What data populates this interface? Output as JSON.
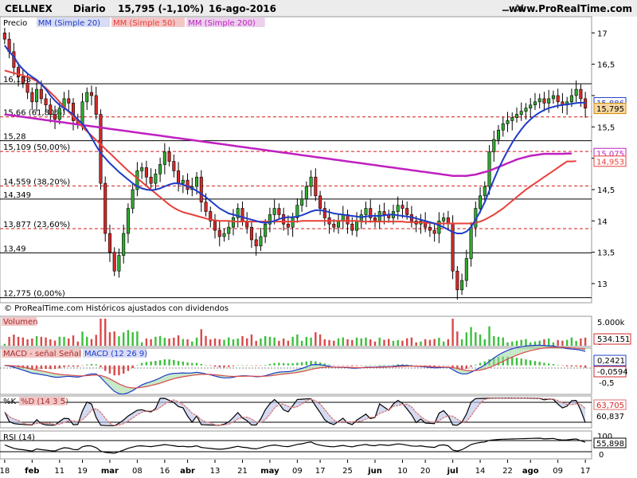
{
  "header": {
    "title": "CELLNEX",
    "period": "Diario",
    "quote": "15,795 (-1,10%)",
    "date": "16-ago-2016",
    "site": "www.ProRealTime.com"
  },
  "icons": {
    "minimize": "minimize-icon",
    "close": "close-icon"
  },
  "colors": {
    "bg": "#ffffff",
    "candle_up": "#2eab2e",
    "candle_down": "#d62828",
    "sma20": "#1e3cc8",
    "sma50": "#e8403a",
    "sma200": "#c020c0",
    "fib_line": "#d01a1a",
    "hline": "#000000",
    "volume": "#3cbf3c",
    "volume_down": "#d84a4a",
    "macd_hist_up": "#3cbf3c",
    "macd_hist_down": "#d84a4a",
    "stoch_k": "#000000",
    "stoch_d": "#d87070",
    "rsi": "#000000"
  },
  "chart_data": {
    "price": {
      "legend": [
        {
          "label": "Precio",
          "color": "#000000"
        },
        {
          "label": "MM (Simple 20)",
          "color": "#1e3cc8"
        },
        {
          "label": "MM (Simple 50)",
          "color": "#e8403a"
        },
        {
          "label": "MM (Simple 200)",
          "color": "#c020c0"
        }
      ],
      "ylim": [
        12.72,
        17.22
      ],
      "yticks": [
        13,
        13.5,
        14,
        14.5,
        15,
        15.5,
        16,
        16.5,
        17
      ],
      "ytick_labels": [
        "13",
        "13,5",
        "14",
        "14,5",
        "",
        "15,5",
        "",
        "16,5",
        "17"
      ],
      "horizontal_levels": [
        {
          "label": "16,188",
          "value": 16.188,
          "style": "solid"
        },
        {
          "label": "15,66 (61,80%)",
          "value": 15.66,
          "style": "dashed"
        },
        {
          "label": "15,28",
          "value": 15.28,
          "style": "solid"
        },
        {
          "label": "15,109 (50,00%)",
          "value": 15.109,
          "style": "dashed"
        },
        {
          "label": "14,559 (38,20%)",
          "value": 14.559,
          "style": "dashed"
        },
        {
          "label": "14,349",
          "value": 14.349,
          "style": "solid"
        },
        {
          "label": "13,877 (23,60%)",
          "value": 13.877,
          "style": "dashed"
        },
        {
          "label": "13,49",
          "value": 13.49,
          "style": "solid"
        },
        {
          "label": "12,775 (0,00%)",
          "value": 12.775,
          "style": "solid"
        }
      ],
      "right_labels": [
        {
          "text": "15,886",
          "value": 15.886,
          "color": "#1e3cc8"
        },
        {
          "text": "15,795",
          "value": 15.795,
          "color": "#000000"
        },
        {
          "text": "15,075",
          "value": 15.075,
          "color": "#c020c0"
        },
        {
          "text": "14,953",
          "value": 14.953,
          "color": "#e8403a"
        }
      ],
      "close": [
        16.9,
        16.7,
        16.45,
        16.3,
        16.2,
        16.05,
        15.9,
        16.1,
        15.95,
        15.85,
        15.7,
        15.62,
        15.8,
        15.95,
        15.88,
        15.6,
        15.55,
        15.9,
        16.05,
        16.0,
        15.7,
        14.6,
        13.8,
        13.5,
        13.2,
        13.45,
        13.8,
        14.2,
        14.5,
        14.8,
        14.85,
        14.7,
        14.6,
        14.75,
        14.9,
        15.1,
        14.95,
        14.8,
        14.6,
        14.65,
        14.5,
        14.55,
        14.7,
        14.3,
        14.15,
        14.0,
        13.85,
        13.75,
        13.8,
        13.9,
        14.05,
        14.2,
        14.0,
        13.9,
        13.7,
        13.6,
        13.75,
        13.95,
        14.1,
        14.2,
        14.1,
        13.95,
        13.9,
        14.05,
        14.25,
        14.35,
        14.55,
        14.7,
        14.4,
        14.2,
        14.05,
        13.95,
        13.9,
        14.0,
        14.1,
        13.95,
        13.85,
        14.0,
        14.1,
        14.2,
        14.05,
        14.0,
        14.15,
        14.1,
        14.05,
        14.15,
        14.25,
        14.2,
        14.1,
        14.0,
        13.95,
        14.0,
        13.9,
        13.85,
        13.8,
        14.0,
        14.05,
        13.95,
        13.2,
        12.9,
        13.05,
        13.4,
        13.9,
        14.2,
        14.4,
        14.55,
        15.1,
        15.3,
        15.45,
        15.55,
        15.6,
        15.65,
        15.7,
        15.75,
        15.8,
        15.85,
        15.9,
        15.95,
        15.88,
        15.95,
        16.0,
        15.9,
        15.85,
        15.9,
        16.0,
        16.1,
        15.95,
        15.8
      ],
      "sma20": [
        16.8,
        16.7,
        16.62,
        16.5,
        16.42,
        16.35,
        16.3,
        16.25,
        16.18,
        16.1,
        16.0,
        15.92,
        15.85,
        15.8,
        15.75,
        15.7,
        15.62,
        15.55,
        15.45,
        15.33,
        15.2,
        15.08,
        15.0,
        14.92,
        14.85,
        14.78,
        14.72,
        14.66,
        14.6,
        14.55,
        14.52,
        14.5,
        14.49,
        14.5,
        14.52,
        14.55,
        14.58,
        14.6,
        14.6,
        14.58,
        14.55,
        14.52,
        14.48,
        14.43,
        14.38,
        14.32,
        14.26,
        14.2,
        14.16,
        14.12,
        14.1,
        14.08,
        14.06,
        14.04,
        14.02,
        14.0,
        13.98,
        13.97,
        13.98,
        14.0,
        14.03,
        14.05,
        14.06,
        14.06,
        14.07,
        14.09,
        14.12,
        14.15,
        14.17,
        14.17,
        14.16,
        14.14,
        14.12,
        14.11,
        14.1,
        14.09,
        14.08,
        14.07,
        14.06,
        14.07,
        14.08,
        14.08,
        14.08,
        14.09,
        14.1,
        14.1,
        14.09,
        14.08,
        14.07,
        14.06,
        14.04,
        14.02,
        14.0,
        13.98,
        13.96,
        13.93,
        13.9,
        13.86,
        13.82,
        13.8,
        13.8,
        13.83,
        13.9,
        14.02,
        14.15,
        14.3,
        14.48,
        14.66,
        14.83,
        14.98,
        15.12,
        15.25,
        15.36,
        15.46,
        15.55,
        15.62,
        15.68,
        15.73,
        15.77,
        15.8,
        15.82,
        15.84,
        15.85,
        15.86,
        15.87,
        15.88,
        15.886,
        15.886
      ],
      "sma50": [
        16.4,
        16.38,
        16.36,
        16.34,
        16.32,
        16.3,
        16.27,
        16.23,
        16.18,
        16.12,
        16.05,
        15.98,
        15.9,
        15.82,
        15.74,
        15.66,
        15.58,
        15.5,
        15.43,
        15.36,
        15.29,
        15.22,
        15.15,
        15.08,
        15.01,
        14.94,
        14.87,
        14.8,
        14.74,
        14.68,
        14.62,
        14.56,
        14.5,
        14.44,
        14.38,
        14.32,
        14.26,
        14.21,
        14.17,
        14.14,
        14.12,
        14.1,
        14.08,
        14.06,
        14.04,
        14.02,
        14.01,
        14.0,
        14.0,
        14.0,
        13.99,
        13.99,
        13.99,
        13.99,
        13.99,
        13.99,
        13.99,
        13.99,
        13.99,
        13.99,
        13.99,
        13.99,
        13.99,
        13.99,
        13.99,
        14.0,
        14.0,
        14.0,
        14.0,
        14.0,
        14.0,
        14.0,
        14.0,
        14.0,
        14.0,
        14.0,
        14.0,
        14.0,
        13.99,
        13.99,
        13.99,
        13.99,
        13.99,
        13.99,
        13.99,
        13.99,
        13.99,
        13.99,
        13.98,
        13.98,
        13.98,
        13.98,
        13.97,
        13.97,
        13.96,
        13.96,
        13.96,
        13.96,
        13.96,
        13.96,
        13.96,
        13.96,
        13.96,
        13.97,
        13.99,
        14.02,
        14.06,
        14.1,
        14.15,
        14.2,
        14.26,
        14.32,
        14.38,
        14.44,
        14.5,
        14.55,
        14.6,
        14.65,
        14.7,
        14.75,
        14.8,
        14.85,
        14.9,
        14.95,
        14.95,
        14.953
      ],
      "sma200": [
        15.7,
        15.69,
        15.68,
        15.67,
        15.66,
        15.65,
        15.64,
        15.63,
        15.62,
        15.61,
        15.6,
        15.59,
        15.58,
        15.57,
        15.56,
        15.55,
        15.54,
        15.53,
        15.52,
        15.51,
        15.5,
        15.49,
        15.48,
        15.47,
        15.46,
        15.45,
        15.44,
        15.43,
        15.42,
        15.41,
        15.4,
        15.39,
        15.38,
        15.37,
        15.36,
        15.35,
        15.34,
        15.33,
        15.32,
        15.31,
        15.3,
        15.29,
        15.28,
        15.27,
        15.26,
        15.25,
        15.24,
        15.23,
        15.22,
        15.21,
        15.2,
        15.19,
        15.18,
        15.17,
        15.16,
        15.15,
        15.14,
        15.13,
        15.12,
        15.11,
        15.1,
        15.09,
        15.08,
        15.07,
        15.06,
        15.05,
        15.04,
        15.03,
        15.02,
        15.01,
        15.0,
        14.99,
        14.98,
        14.97,
        14.96,
        14.95,
        14.94,
        14.93,
        14.92,
        14.91,
        14.9,
        14.89,
        14.88,
        14.87,
        14.86,
        14.85,
        14.84,
        14.83,
        14.82,
        14.81,
        14.8,
        14.79,
        14.78,
        14.77,
        14.76,
        14.75,
        14.74,
        14.73,
        14.72,
        14.72,
        14.72,
        14.72,
        14.73,
        14.74,
        14.76,
        14.78,
        14.8,
        14.83,
        14.86,
        14.89,
        14.92,
        14.95,
        14.98,
        15.0,
        15.02,
        15.04,
        15.05,
        15.06,
        15.07,
        15.07,
        15.07,
        15.07,
        15.07,
        15.075,
        15.075
      ]
    },
    "volume": {
      "label": "Volumen",
      "yticks": [
        "5.000k",
        "0"
      ],
      "right_label": "534.151",
      "ymax_k": 5800
    },
    "macd": {
      "label": "MACD",
      "legend": [
        {
          "label": "MACD - señal",
          "color": "#d84a4a"
        },
        {
          "label": "Señal",
          "color": "#e06060"
        },
        {
          "label": "MACD (12 26 9)",
          "color": "#1e3cc8"
        }
      ],
      "yticks": [
        "0",
        "-0,5"
      ],
      "right_labels": [
        "0,2421",
        "-0,0594"
      ],
      "ylim": [
        -0.7,
        0.4
      ]
    },
    "stochastic": {
      "label": "%K",
      "legend": [
        {
          "label": "%D (14 3 5)",
          "color": "#d87070"
        }
      ],
      "right_labels": [
        "63,705",
        "60,837"
      ]
    },
    "rsi": {
      "label": "RSI (14)",
      "yticks": [
        "100",
        "0"
      ],
      "right_label": "55,898"
    },
    "x_ticks": [
      "18",
      "feb",
      "11",
      "19",
      "mar",
      "08",
      "16",
      "abr",
      "13",
      "21",
      "may",
      "09",
      "17",
      "25",
      "jun",
      "10",
      "20",
      "jul",
      "14",
      "22",
      "ago",
      "09",
      "17"
    ],
    "footer": "© ProRealTime.com  Históricos ajustados con dividendos"
  }
}
